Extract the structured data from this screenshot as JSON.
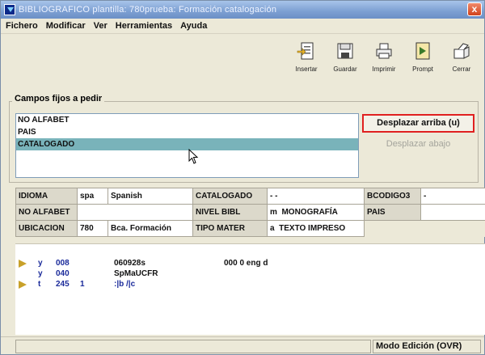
{
  "window": {
    "title": "BIBLIOGRAFICO plantilla: 780prueba: Formación catalogación",
    "close_label": "x"
  },
  "menu": [
    {
      "label": "Fichero"
    },
    {
      "label": "Modificar"
    },
    {
      "label": "Ver"
    },
    {
      "label": "Herramientas"
    },
    {
      "label": "Ayuda"
    }
  ],
  "toolbar": {
    "insertar": "Insertar",
    "guardar": "Guardar",
    "imprimir": "Imprimir",
    "prompt": "Prompt",
    "cerrar": "Cerrar"
  },
  "campos_fijos": {
    "group_title": "Campos fijos a pedir",
    "items": [
      "NO ALFABET",
      "PAIS",
      "CATALOGADO"
    ],
    "selected": "CATALOGADO",
    "btn_up": "Desplazar arriba (u)",
    "btn_down": "Desplazar abajo"
  },
  "fixed_fields": {
    "r1": {
      "l1": "IDIOMA",
      "v1a": "spa",
      "v1b": "Spanish",
      "l2": "CATALOGADO",
      "v2": "- -",
      "l3": "BCODIGO3",
      "v3": "-"
    },
    "r2": {
      "l1": "NO ALFABET",
      "v1": "",
      "l2": "NIVEL BIBL",
      "v2a": "m",
      "v2b": "MONOGRAFÍA",
      "l3": "PAIS",
      "v3": ""
    },
    "r3": {
      "l1": "UBICACION",
      "v1a": "780",
      "v1b": "Bca. Formación",
      "l2": "TIPO MATER",
      "v2a": "a",
      "v2b": "TEXTO IMPRESO"
    }
  },
  "marc": [
    {
      "ind": "y",
      "tag": "008",
      "ind1": "",
      "content": "060928s",
      "extra": "000 0 eng d"
    },
    {
      "ind": "y",
      "tag": "040",
      "ind1": "",
      "content": "SpMaUCFR",
      "extra": ""
    },
    {
      "ind": "t",
      "tag": "245",
      "ind1": "1",
      "content": ":|b /|c",
      "extra": ""
    }
  ],
  "status": {
    "left": "",
    "mode": "Modo Edición (OVR)"
  },
  "colors": {
    "selected_row": "#79b3ba",
    "focus_border": "#e02020",
    "marc_blue": "#1a2a9a",
    "arrow": "#c8a12a"
  }
}
